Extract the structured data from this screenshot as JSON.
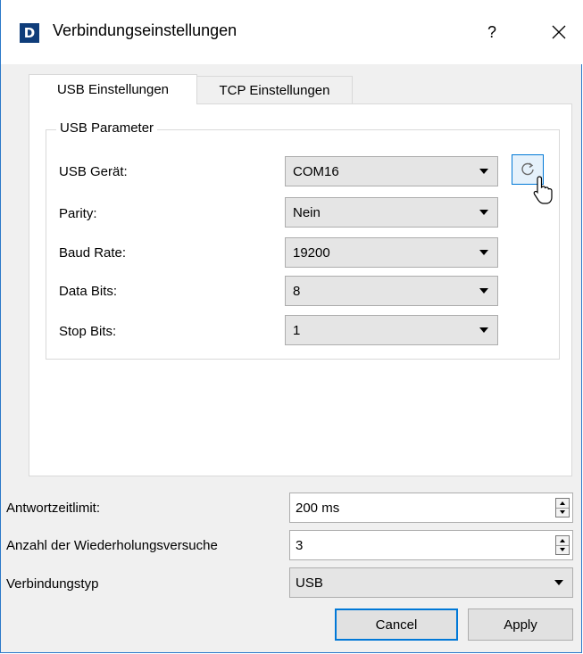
{
  "window": {
    "title": "Verbindungseinstellungen",
    "app_icon_letter": "D",
    "help_label": "?",
    "accent_color": "#0078d7",
    "icon_bg_color": "#0f3d7a"
  },
  "tabs": [
    {
      "label": "USB Einstellungen",
      "active": true
    },
    {
      "label": "TCP Einstellungen",
      "active": false
    }
  ],
  "usb_group": {
    "title": "USB Parameter",
    "rows": [
      {
        "label": "USB Gerät:",
        "value": "COM16"
      },
      {
        "label": "Parity:",
        "value": "Nein"
      },
      {
        "label": "Baud Rate:",
        "value": "19200"
      },
      {
        "label": "Data Bits:",
        "value": "8"
      },
      {
        "label": "Stop Bits:",
        "value": "1"
      }
    ],
    "refresh_icon": "refresh-icon"
  },
  "bottom": {
    "timeout_label": "Antwortzeitlimit:",
    "timeout_value": "200 ms",
    "retries_label": "Anzahl der Wiederholungsversuche",
    "retries_value": "3",
    "conn_type_label": "Verbindungstyp",
    "conn_type_value": "USB"
  },
  "buttons": {
    "cancel": "Cancel",
    "apply": "Apply"
  }
}
